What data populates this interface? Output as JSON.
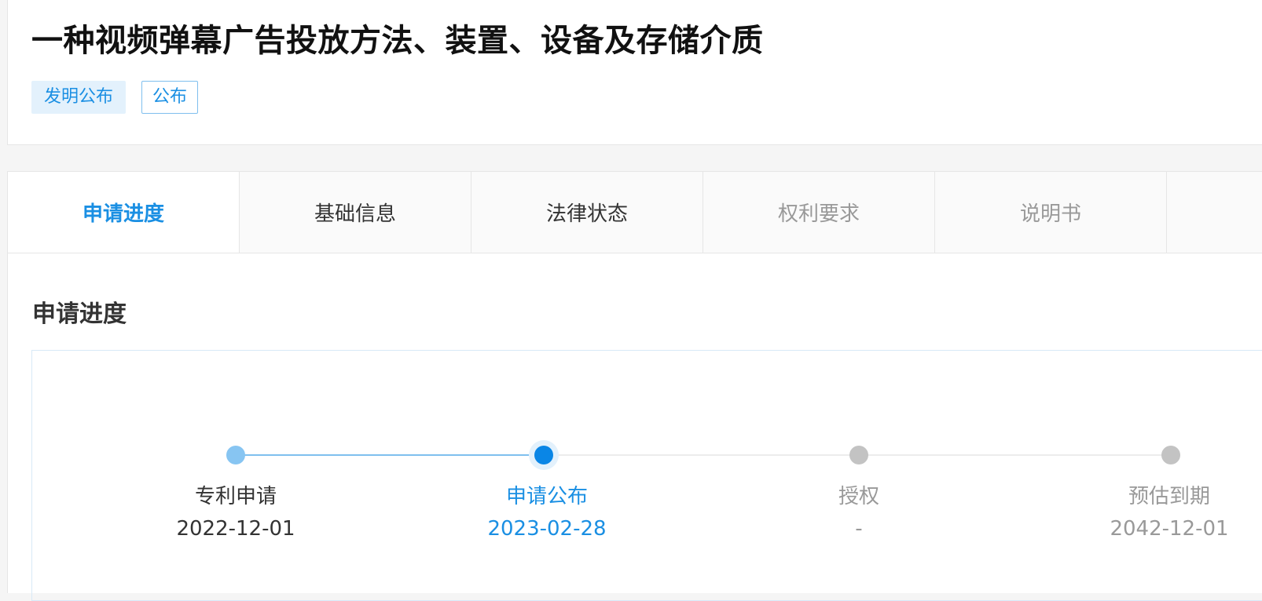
{
  "header": {
    "title": "一种视频弹幕广告投放方法、装置、设备及存储介质",
    "tags": [
      "发明公布",
      "公布"
    ]
  },
  "tabs": [
    {
      "label": "申请进度",
      "state": "active"
    },
    {
      "label": "基础信息",
      "state": "normal"
    },
    {
      "label": "法律状态",
      "state": "normal"
    },
    {
      "label": "权利要求",
      "state": "muted"
    },
    {
      "label": "说明书",
      "state": "muted"
    }
  ],
  "progress": {
    "section_title": "申请进度",
    "steps": [
      {
        "label": "专利申请",
        "date": "2022-12-01",
        "status": "done"
      },
      {
        "label": "申请公布",
        "date": "2023-02-28",
        "status": "current"
      },
      {
        "label": "授权",
        "date": "-",
        "status": "pending"
      },
      {
        "label": "预估到期",
        "date": "2042-12-01",
        "status": "pending"
      }
    ]
  },
  "colors": {
    "accent": "#1a8fe3",
    "done_dot": "#87c5f2",
    "pending_dot": "#c3c3c3"
  }
}
